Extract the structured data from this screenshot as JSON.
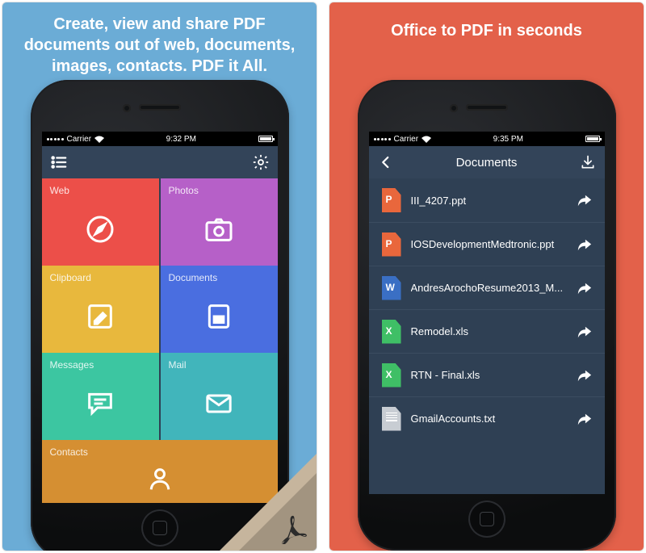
{
  "leftPanel": {
    "headline": "Create, view and share PDF documents out of web, documents, images, contacts. PDF it All.",
    "statusbar": {
      "carrier": "Carrier",
      "time": "9:32 PM"
    },
    "tiles": {
      "web": {
        "label": "Web",
        "color": "#ec4f49",
        "icon": "compass-icon"
      },
      "photos": {
        "label": "Photos",
        "color": "#b660c8",
        "icon": "camera-icon"
      },
      "clipboard": {
        "label": "Clipboard",
        "color": "#e8b83d",
        "icon": "note-edit-icon"
      },
      "documents": {
        "label": "Documents",
        "color": "#4a6ee0",
        "icon": "document-icon"
      },
      "messages": {
        "label": "Messages",
        "color": "#3cc6a1",
        "icon": "chat-icon"
      },
      "mail": {
        "label": "Mail",
        "color": "#41b5bb",
        "icon": "mail-icon"
      },
      "contacts": {
        "label": "Contacts",
        "color": "#d58f32",
        "icon": "person-icon"
      }
    }
  },
  "rightPanel": {
    "headline": "Office to PDF in seconds",
    "statusbar": {
      "carrier": "Carrier",
      "time": "9:35 PM"
    },
    "navTitle": "Documents",
    "files": [
      {
        "name": "III_4207.ppt",
        "color": "#e9673c",
        "letter": "P"
      },
      {
        "name": "IOSDevelopmentMedtronic.ppt",
        "color": "#e9673c",
        "letter": "P"
      },
      {
        "name": "AndresArochoResume2013_M...",
        "color": "#3a6fc4",
        "letter": "W"
      },
      {
        "name": "Remodel.xls",
        "color": "#3fbf66",
        "letter": "X"
      },
      {
        "name": "RTN - Final.xls",
        "color": "#3fbf66",
        "letter": "X"
      },
      {
        "name": "GmailAccounts.txt",
        "color": "#c8cdd3",
        "letter": ""
      }
    ]
  }
}
